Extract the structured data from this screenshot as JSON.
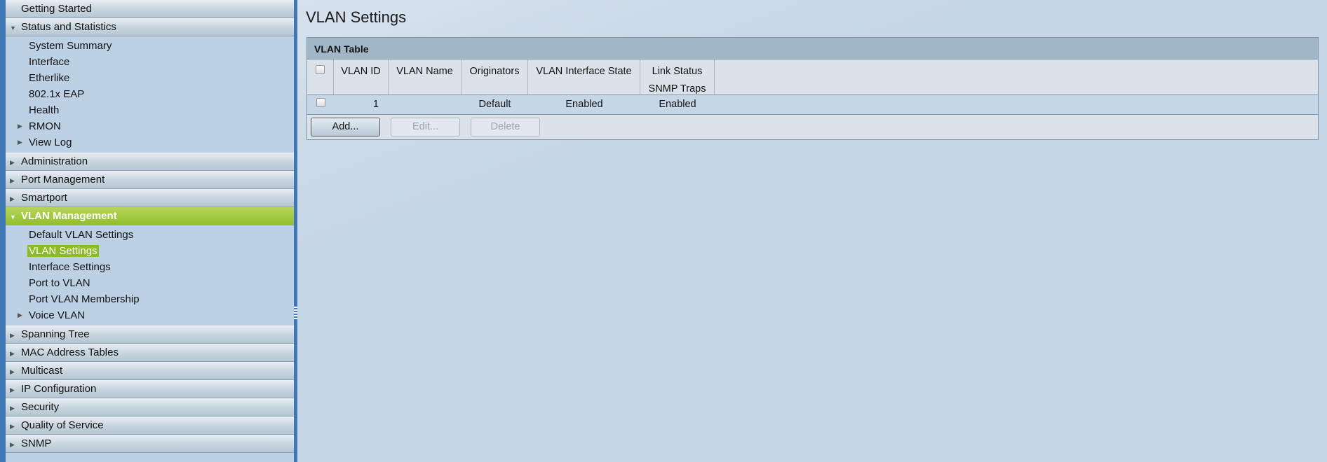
{
  "sidebar": {
    "getting_started": "Getting Started",
    "status": {
      "label": "Status and Statistics",
      "items": [
        "System Summary",
        "Interface",
        "Etherlike",
        "802.1x EAP",
        "Health",
        "RMON",
        "View Log"
      ]
    },
    "administration": "Administration",
    "port_management": "Port Management",
    "smartport": "Smartport",
    "vlan": {
      "label": "VLAN Management",
      "items": [
        "Default VLAN Settings",
        "VLAN Settings",
        "Interface Settings",
        "Port to VLAN",
        "Port VLAN Membership",
        "Voice VLAN"
      ]
    },
    "rest": [
      "Spanning Tree",
      "MAC Address Tables",
      "Multicast",
      "IP Configuration",
      "Security",
      "Quality of Service",
      "SNMP"
    ]
  },
  "page": {
    "title": "VLAN Settings"
  },
  "table": {
    "caption": "VLAN Table",
    "headers": {
      "id": "VLAN ID",
      "name": "VLAN Name",
      "orig": "Originators",
      "state": "VLAN Interface State",
      "link1": "Link Status",
      "link2": "SNMP Traps"
    },
    "rows": [
      {
        "id": "1",
        "name": "",
        "orig": "Default",
        "state": "Enabled",
        "link": "Enabled"
      }
    ],
    "buttons": {
      "add": "Add...",
      "edit": "Edit...",
      "delete": "Delete"
    }
  },
  "colors": {
    "accent": "#93be2e",
    "frame": "#3f78b5"
  }
}
